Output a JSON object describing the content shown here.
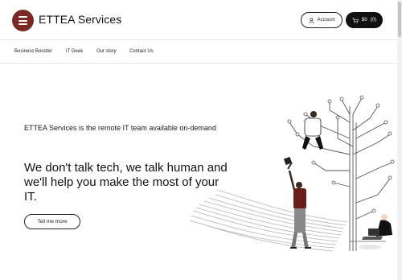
{
  "header": {
    "brand": "ETTEA Services",
    "account_label": "Account",
    "cart_price": "$0",
    "cart_count": "(0)"
  },
  "nav": {
    "items": [
      "Business Booster",
      "IT Geek",
      "Our story",
      "Contact Us"
    ]
  },
  "hero": {
    "tagline": "ETTEA Services is the remote IT team available on-demand",
    "headline": "We don't talk tech, we talk human and we'll help you make the most of your IT.",
    "cta_label": "Tell me more"
  },
  "colors": {
    "brand": "#7a2a22",
    "cart_button": "#111111",
    "shirt": "#6b1f1a"
  },
  "icons": {
    "account": "user-icon",
    "cart": "cart-icon"
  }
}
